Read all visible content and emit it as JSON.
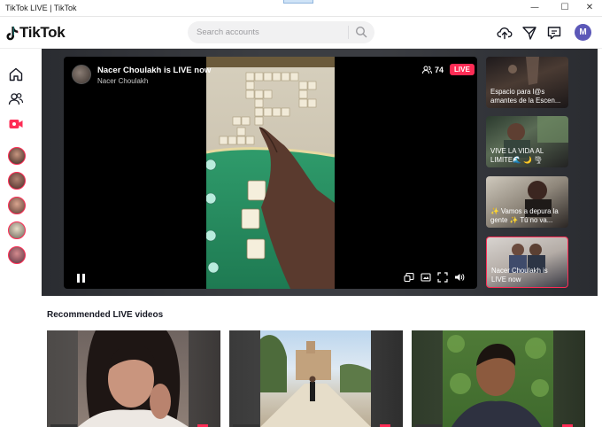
{
  "window": {
    "title": "TikTok LIVE | TikTok",
    "controls": [
      "—",
      "☐",
      "✕"
    ]
  },
  "header": {
    "logo_text": "TikTok",
    "search_placeholder": "Search accounts",
    "avatar_letter": "M",
    "icons": [
      "upload-icon",
      "inbox-filter-icon",
      "message-icon"
    ]
  },
  "sidebar": {
    "items": [
      {
        "name": "home",
        "icon": "home-icon"
      },
      {
        "name": "following",
        "icon": "following-icon"
      },
      {
        "name": "live",
        "icon": "live-icon",
        "color": "#fe2c55"
      }
    ],
    "live_avatars": 5
  },
  "player": {
    "host_name": "Nacer Choulakh is LIVE now",
    "host_sub": "Nacer Choulakh",
    "viewers": "74",
    "live_badge": "LIVE"
  },
  "side_lives": [
    {
      "caption": "Espacio para l@s amantes de la Escen..."
    },
    {
      "caption": "VIVE LA VIDA AL LIMITE🌊 🌙 🌪"
    },
    {
      "caption": "✨ Vamos a depura la gente ✨ Tú no va..."
    },
    {
      "caption": "Nacer Choulakh is LIVE now",
      "active": true
    }
  ],
  "recommended": {
    "title": "Recommended LIVE videos"
  },
  "colors": {
    "accent": "#fe2c55",
    "avatar": "#5c58b8"
  }
}
